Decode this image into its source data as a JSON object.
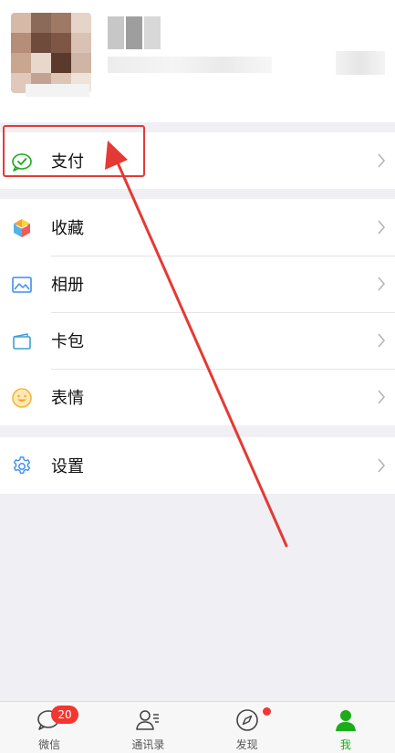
{
  "menu": {
    "pay": {
      "label": "支付",
      "icon": "wallet-icon"
    },
    "items": [
      {
        "label": "收藏",
        "icon": "favorites-cube-icon"
      },
      {
        "label": "相册",
        "icon": "album-icon"
      },
      {
        "label": "卡包",
        "icon": "card-wallet-icon"
      },
      {
        "label": "表情",
        "icon": "emoji-smile-icon"
      }
    ],
    "settings": {
      "label": "设置",
      "icon": "gear-icon"
    }
  },
  "tabbar": {
    "tabs": [
      {
        "label": "微信",
        "icon": "chat-bubble-icon",
        "badge": "20"
      },
      {
        "label": "通讯录",
        "icon": "contacts-icon"
      },
      {
        "label": "发现",
        "icon": "compass-icon",
        "dot": true
      },
      {
        "label": "我",
        "icon": "person-icon",
        "active": true
      }
    ]
  },
  "colors": {
    "accent": "#1aad19",
    "badge": "#f43530",
    "annotation": "#e53935",
    "background": "#efeff4"
  }
}
